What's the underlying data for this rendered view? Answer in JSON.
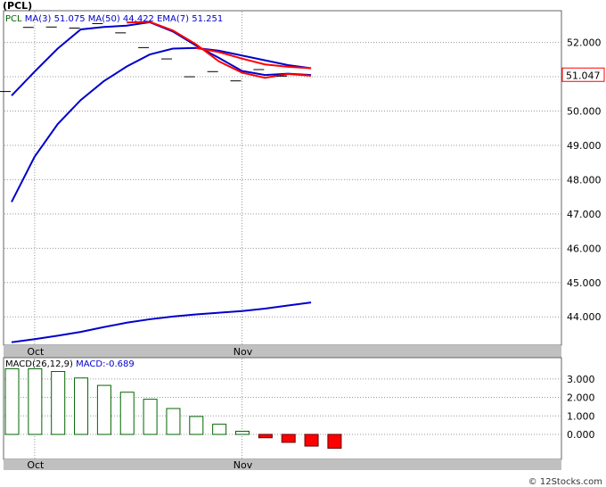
{
  "ticker_label": "(PCL)",
  "footer": "© 12Stocks.com",
  "colors": {
    "price": "#000000",
    "ma3": "#ff0000",
    "ma50": "#0000cc",
    "ema7": "#0000cc",
    "grid": "#9a9a9a",
    "macd_pos": "#ffffff",
    "macd_pos_stroke": "#006600",
    "macd_neg": "#ff0000",
    "price_box": "#ff0000",
    "panel_bg": "#c0c0c0"
  },
  "chart_data": [
    {
      "type": "line",
      "legend": [
        {
          "label": "PCL",
          "color": "#006600"
        },
        {
          "label": "MA(3)",
          "value": "51.075",
          "color": "#0000cc"
        },
        {
          "label": "MA(50)",
          "value": "44.422",
          "color": "#0000cc"
        },
        {
          "label": "EMA(7)",
          "value": "51.251",
          "color": "#0000cc"
        }
      ],
      "x_ticks": [
        "Oct",
        "Nov"
      ],
      "x_tick_index": [
        1,
        10
      ],
      "y_ticks": [
        "44.000",
        "45.000",
        "46.000",
        "47.000",
        "48.000",
        "49.000",
        "50.000",
        "51.000",
        "52.000"
      ],
      "ylim": [
        43.2,
        52.9
      ],
      "current_price_label": "51.047",
      "current_price": 51.047,
      "price_ticks": [
        50.57,
        52.44,
        52.45,
        52.42,
        52.55,
        52.28,
        51.85,
        51.52,
        51.0,
        51.15,
        50.88,
        51.21,
        51.02
      ],
      "series": [
        {
          "name": "MA(3)",
          "color": "#0000cc",
          "values": [
            50.45,
            51.15,
            51.82,
            52.38,
            52.45,
            52.49,
            52.59,
            52.32,
            51.91,
            51.55,
            51.17,
            51.05,
            51.09,
            51.05
          ]
        },
        {
          "name": "EMA(7)",
          "color": "#0000cc",
          "values": [
            47.35,
            48.67,
            49.62,
            50.32,
            50.87,
            51.3,
            51.65,
            51.82,
            51.84,
            51.76,
            51.62,
            51.48,
            51.34,
            51.25
          ]
        },
        {
          "name": "",
          "color": "#ff0000",
          "from_index": 5,
          "values": [
            52.58,
            52.6,
            52.35,
            51.95,
            51.45,
            51.12,
            50.97,
            51.08,
            51.03
          ]
        },
        {
          "name": "",
          "color": "#ff0000",
          "from_index": 8,
          "values": [
            51.84,
            51.72,
            51.53,
            51.36,
            51.29,
            51.25
          ]
        },
        {
          "name": "MA(50)",
          "color": "#0000cc",
          "values": [
            43.26,
            43.35,
            43.45,
            43.56,
            43.7,
            43.83,
            43.93,
            44.01,
            44.07,
            44.12,
            44.17,
            44.24,
            44.33,
            44.42
          ]
        }
      ]
    },
    {
      "type": "bar",
      "legend": [
        {
          "label": "MACD(26,12,9)",
          "color": "#000000"
        },
        {
          "label": "MACD:-0.689",
          "color": "#0000cc"
        }
      ],
      "x_ticks": [
        "Oct",
        "Nov"
      ],
      "x_tick_index": [
        1,
        10
      ],
      "y_ticks": [
        "0.000",
        "1.000",
        "2.000",
        "3.000"
      ],
      "ylim": [
        -1.3,
        4.1
      ],
      "values": [
        3.55,
        3.55,
        3.4,
        3.05,
        2.65,
        2.28,
        1.9,
        1.4,
        0.97,
        0.55,
        0.17,
        -0.18,
        -0.43,
        -0.63,
        -0.75
      ]
    }
  ]
}
